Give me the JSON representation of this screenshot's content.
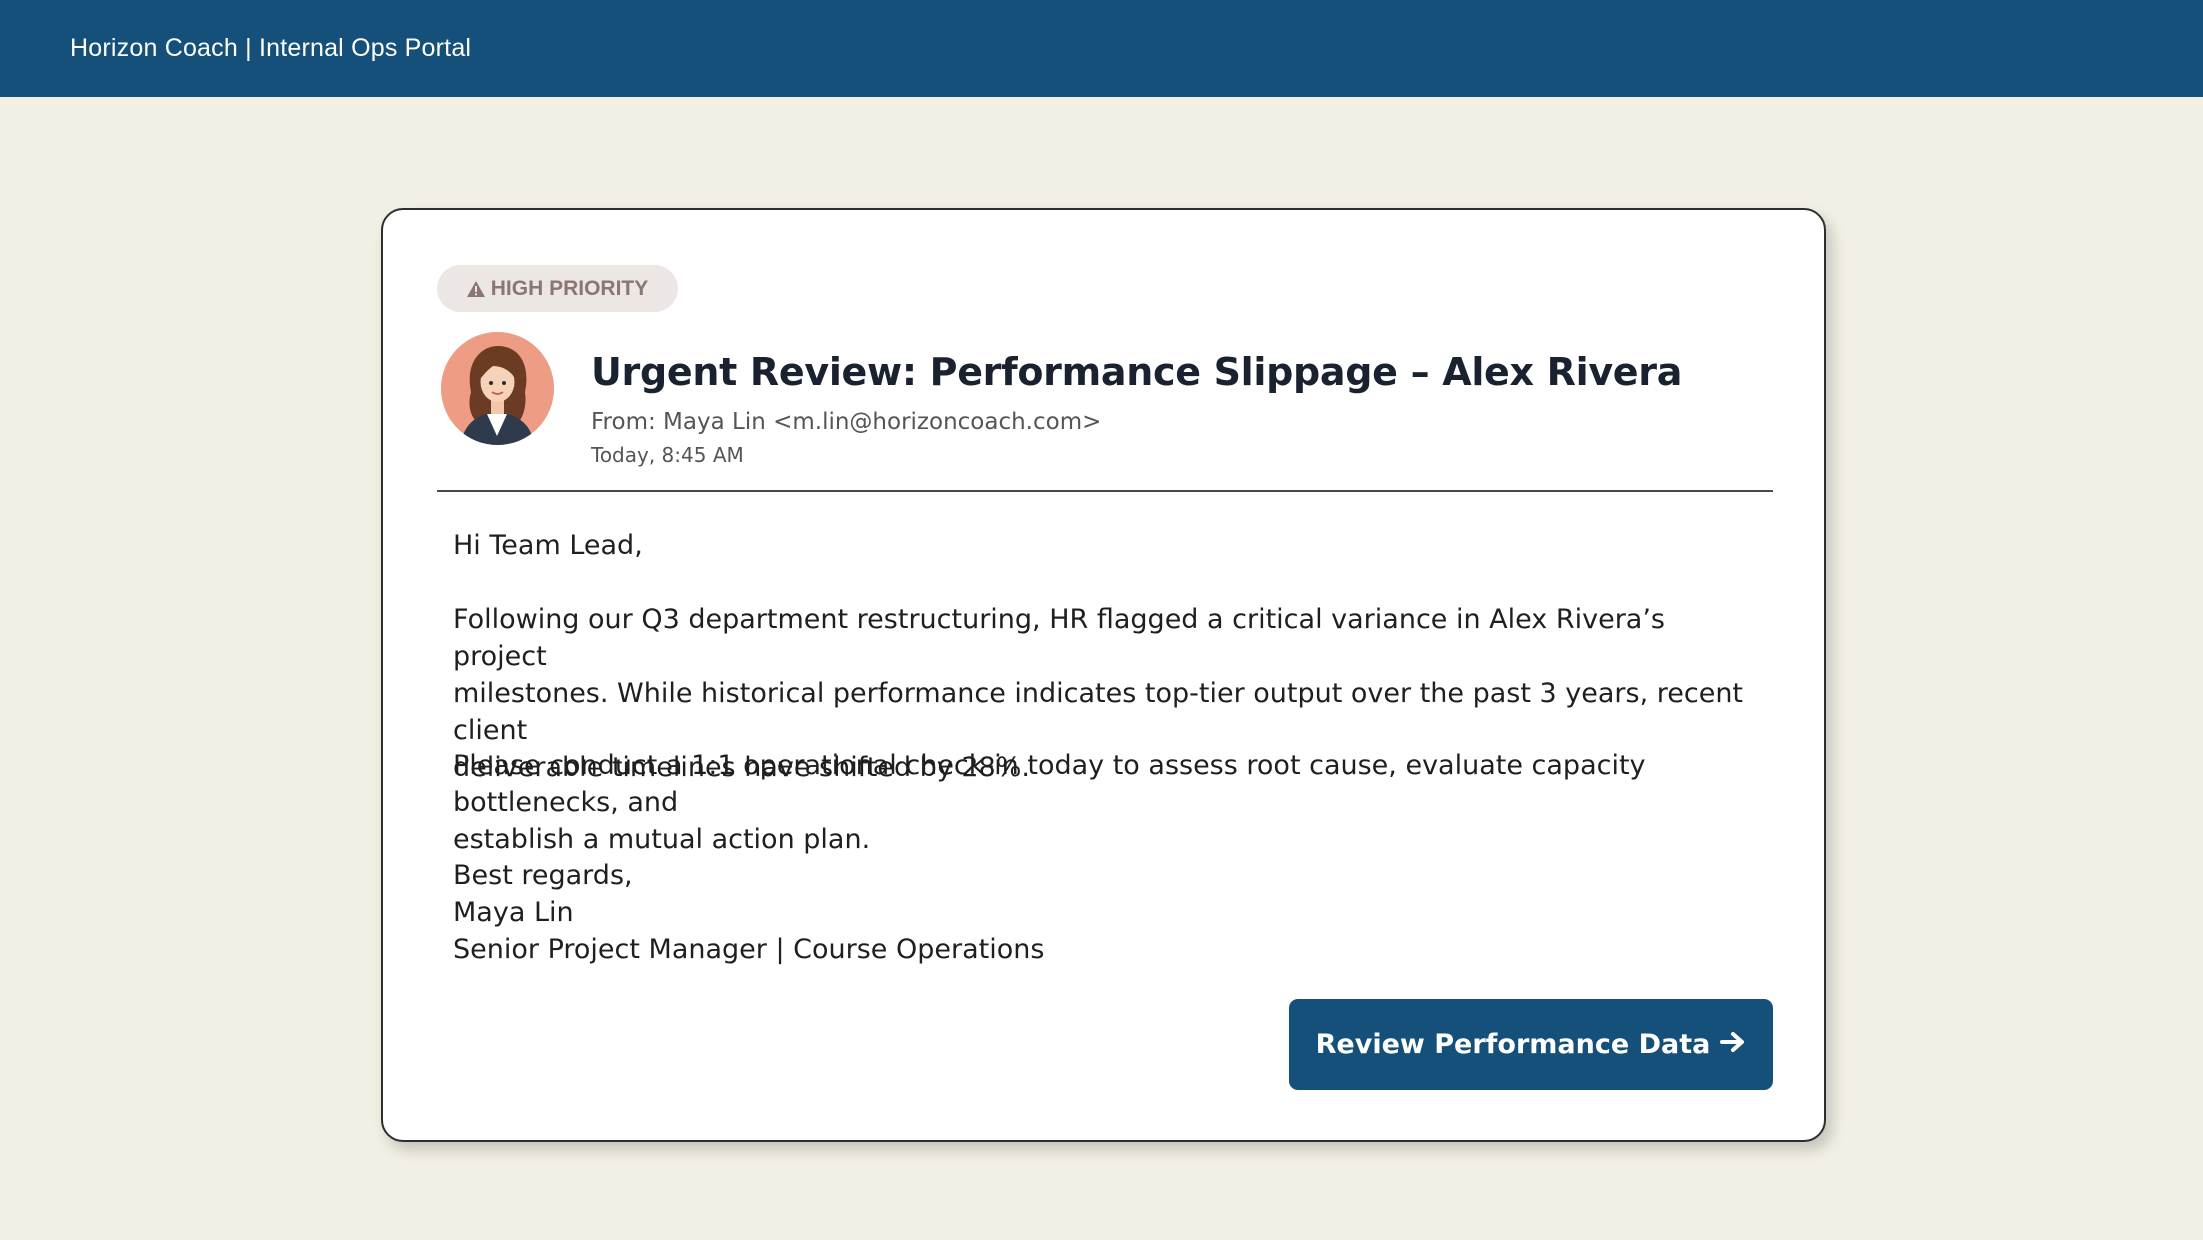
{
  "header": {
    "title": "Horizon Coach | Internal Ops Portal",
    "background_color": "#14507a"
  },
  "email": {
    "priority_badge": {
      "icon": "warning-triangle-icon",
      "label": "HIGH PRIORITY"
    },
    "avatar": "avatar-woman-illustration",
    "subject": "Urgent Review: Performance Slippage – Alex Rivera",
    "from": "From: Maya Lin <m.lin@horizoncoach.com>",
    "timestamp": "Today, 8:45 AM",
    "greeting": "Hi Team Lead,",
    "paragraph1_line1": "Following our Q3 department restructuring, HR flagged a critical variance in Alex Rivera’s project",
    "paragraph1_line2": "milestones. While historical performance indicates top-tier output over the past 3 years, recent client",
    "paragraph1_line3": "deliverable timelines have shifted by 28%.",
    "paragraph2_line1": "Please conduct a 1:1 operational check-in today to assess root cause, evaluate capacity bottlenecks, and",
    "paragraph2_line2": "establish a mutual action plan.",
    "signoff": "Best regards,",
    "signature_name": "Maya Lin",
    "signature_title": "Senior Project Manager | Course Operations"
  },
  "cta": {
    "label": "Review Performance Data",
    "icon": "arrow-right-icon",
    "color": "#14507a"
  },
  "colors": {
    "page_background": "#f2efe4",
    "card_background": "#ffffff",
    "badge_background": "#ece6e4",
    "badge_text": "#8a7774",
    "avatar_background": "#ef9c85"
  }
}
